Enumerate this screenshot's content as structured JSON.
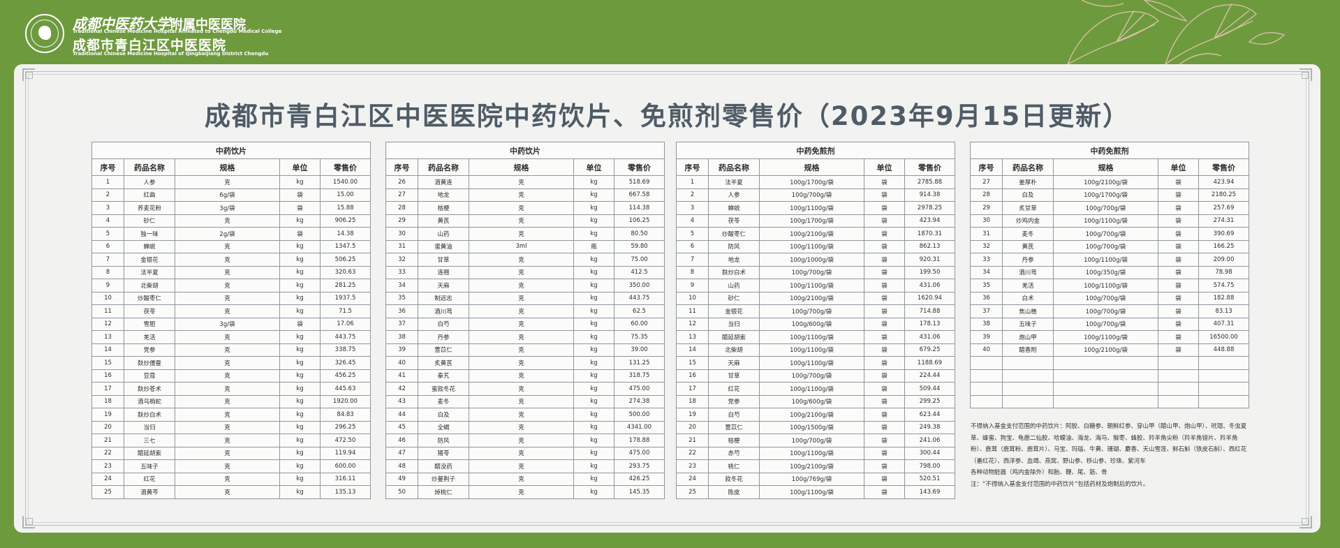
{
  "header": {
    "hospital_cn_calligraphy": "成都中医药大学",
    "hospital_cn_suffix": "附属中医医院",
    "hospital_en_1": "Traditional Chinese Medicine Hospital Affiliated to Chengdu Medical College",
    "hospital_cn_2": "成都市青白江区中医医院",
    "hospital_en_2": "Traditional Chinese Medicine Hospital of Qingbaijiang District Chengdu"
  },
  "title": "成都市青白江区中医医院中药饮片、免煎剂零售价（2023年9月15日更新）",
  "columns": [
    "序号",
    "药品名称",
    "规格",
    "单位",
    "零售价"
  ],
  "tables": [
    {
      "heading": "中药饮片",
      "rows": [
        [
          "1",
          "人参",
          "克",
          "kg",
          "1540.00"
        ],
        [
          "2",
          "红曲",
          "6g/袋",
          "袋",
          "15.00"
        ],
        [
          "3",
          "荞麦花粉",
          "3g/袋",
          "袋",
          "15.88"
        ],
        [
          "4",
          "砂仁",
          "克",
          "kg",
          "906.25"
        ],
        [
          "5",
          "独一味",
          "2g/袋",
          "袋",
          "14.38"
        ],
        [
          "6",
          "蝉蜕",
          "克",
          "kg",
          "1347.5"
        ],
        [
          "7",
          "金银花",
          "克",
          "kg",
          "506.25"
        ],
        [
          "8",
          "法半夏",
          "克",
          "kg",
          "320.63"
        ],
        [
          "9",
          "北柴胡",
          "克",
          "kg",
          "281.25"
        ],
        [
          "10",
          "炒酸枣仁",
          "克",
          "kg",
          "1937.5"
        ],
        [
          "11",
          "茯苓",
          "克",
          "kg",
          "71.5"
        ],
        [
          "12",
          "雪胆",
          "3g/袋",
          "袋",
          "17.06"
        ],
        [
          "13",
          "羌活",
          "克",
          "kg",
          "443.75"
        ],
        [
          "14",
          "党参",
          "克",
          "kg",
          "338.75"
        ],
        [
          "15",
          "麸炒僵蚕",
          "克",
          "kg",
          "326.45"
        ],
        [
          "16",
          "豆蔻",
          "克",
          "kg",
          "456.25"
        ],
        [
          "17",
          "麸炒苍术",
          "克",
          "kg",
          "445.63"
        ],
        [
          "18",
          "酒乌梢蛇",
          "克",
          "kg",
          "1920.00"
        ],
        [
          "19",
          "麸炒白术",
          "克",
          "kg",
          "84.83"
        ],
        [
          "20",
          "当归",
          "克",
          "kg",
          "296.25"
        ],
        [
          "21",
          "三七",
          "克",
          "kg",
          "472.50"
        ],
        [
          "22",
          "醋延胡索",
          "克",
          "kg",
          "119.94"
        ],
        [
          "23",
          "五味子",
          "克",
          "kg",
          "600.00"
        ],
        [
          "24",
          "红花",
          "克",
          "kg",
          "316.11"
        ],
        [
          "25",
          "酒黄芩",
          "克",
          "kg",
          "135.13"
        ]
      ]
    },
    {
      "heading": "中药饮片",
      "rows": [
        [
          "26",
          "酒黄连",
          "克",
          "kg",
          "518.69"
        ],
        [
          "27",
          "地龙",
          "克",
          "kg",
          "667.58"
        ],
        [
          "28",
          "桔梗",
          "克",
          "kg",
          "114.38"
        ],
        [
          "29",
          "黄芪",
          "克",
          "kg",
          "106.25"
        ],
        [
          "30",
          "山药",
          "克",
          "kg",
          "80.50"
        ],
        [
          "31",
          "蛋黄油",
          "3ml",
          "瓶",
          "59.80"
        ],
        [
          "32",
          "甘草",
          "克",
          "kg",
          "75.00"
        ],
        [
          "33",
          "连翘",
          "克",
          "kg",
          "412.5"
        ],
        [
          "34",
          "天麻",
          "克",
          "kg",
          "350.00"
        ],
        [
          "35",
          "制远志",
          "克",
          "kg",
          "443.75"
        ],
        [
          "36",
          "酒川芎",
          "克",
          "kg",
          "62.5"
        ],
        [
          "37",
          "白芍",
          "克",
          "kg",
          "60.00"
        ],
        [
          "38",
          "丹参",
          "克",
          "kg",
          "75.35"
        ],
        [
          "39",
          "薏苡仁",
          "克",
          "kg",
          "39.00"
        ],
        [
          "40",
          "炙黄芪",
          "克",
          "kg",
          "131.25"
        ],
        [
          "41",
          "秦艽",
          "克",
          "kg",
          "318.75"
        ],
        [
          "42",
          "蜜款冬花",
          "克",
          "kg",
          "475.00"
        ],
        [
          "43",
          "麦冬",
          "克",
          "kg",
          "274.38"
        ],
        [
          "44",
          "白及",
          "克",
          "kg",
          "500.00"
        ],
        [
          "45",
          "全蝎",
          "克",
          "kg",
          "4341.00"
        ],
        [
          "46",
          "防风",
          "克",
          "kg",
          "178.88"
        ],
        [
          "47",
          "猪苓",
          "克",
          "kg",
          "475.00"
        ],
        [
          "48",
          "醋没药",
          "克",
          "kg",
          "293.75"
        ],
        [
          "49",
          "炒蔓荆子",
          "克",
          "kg",
          "426.25"
        ],
        [
          "50",
          "焯桃仁",
          "克",
          "kg",
          "145.35"
        ]
      ]
    },
    {
      "heading": "中药免煎剂",
      "rows": [
        [
          "1",
          "法半夏",
          "100g/1700g/袋",
          "袋",
          "2785.88"
        ],
        [
          "2",
          "人参",
          "100g/700g/袋",
          "袋",
          "914.38"
        ],
        [
          "3",
          "蝉蜕",
          "100g/1100g/袋",
          "袋",
          "2978.25"
        ],
        [
          "4",
          "茯苓",
          "100g/1700g/袋",
          "袋",
          "423.94"
        ],
        [
          "5",
          "炒酸枣仁",
          "100g/2100g/袋",
          "袋",
          "1870.31"
        ],
        [
          "6",
          "防风",
          "100g/1100g/袋",
          "袋",
          "862.13"
        ],
        [
          "7",
          "地龙",
          "100g/1000g/袋",
          "袋",
          "920.31"
        ],
        [
          "8",
          "麸炒白术",
          "100g/700g/袋",
          "袋",
          "199.50"
        ],
        [
          "9",
          "山药",
          "100g/1100g/袋",
          "袋",
          "431.06"
        ],
        [
          "10",
          "砂仁",
          "100g/2100g/袋",
          "袋",
          "1620.94"
        ],
        [
          "11",
          "金银花",
          "100g/700g/袋",
          "袋",
          "714.88"
        ],
        [
          "12",
          "当归",
          "100g/600g/袋",
          "袋",
          "178.13"
        ],
        [
          "13",
          "醋延胡索",
          "100g/1100g/袋",
          "袋",
          "431.06"
        ],
        [
          "14",
          "北柴胡",
          "100g/1100g/袋",
          "袋",
          "679.25"
        ],
        [
          "15",
          "天麻",
          "100g/1100g/袋",
          "袋",
          "1188.69"
        ],
        [
          "16",
          "甘草",
          "100g/700g/袋",
          "袋",
          "224.44"
        ],
        [
          "17",
          "红花",
          "100g/1100g/袋",
          "袋",
          "509.44"
        ],
        [
          "18",
          "党参",
          "100g/600g/袋",
          "袋",
          "299.25"
        ],
        [
          "19",
          "白芍",
          "100g/2100g/袋",
          "袋",
          "623.44"
        ],
        [
          "20",
          "薏苡仁",
          "100g/1500g/袋",
          "袋",
          "249.38"
        ],
        [
          "21",
          "桔梗",
          "100g/700g/袋",
          "袋",
          "241.06"
        ],
        [
          "22",
          "赤芍",
          "100g/1100g/袋",
          "袋",
          "300.44"
        ],
        [
          "23",
          "桃仁",
          "100g/2100g/袋",
          "袋",
          "798.00"
        ],
        [
          "24",
          "款冬花",
          "100g/769g/袋",
          "袋",
          "520.51"
        ],
        [
          "25",
          "陈皮",
          "100g/1100g/袋",
          "袋",
          "143.69"
        ]
      ]
    },
    {
      "heading": "中药免煎剂",
      "rows": [
        [
          "27",
          "姜厚朴",
          "100g/2100g/袋",
          "袋",
          "423.94"
        ],
        [
          "28",
          "白及",
          "100g/1700g/袋",
          "袋",
          "2180.25"
        ],
        [
          "29",
          "炙甘草",
          "100g/700g/袋",
          "袋",
          "257.69"
        ],
        [
          "30",
          "炒鸡内金",
          "100g/1100g/袋",
          "袋",
          "274.31"
        ],
        [
          "31",
          "麦冬",
          "100g/700g/袋",
          "袋",
          "390.69"
        ],
        [
          "32",
          "黄芪",
          "100g/700g/袋",
          "袋",
          "166.25"
        ],
        [
          "33",
          "丹参",
          "100g/1100g/袋",
          "袋",
          "209.00"
        ],
        [
          "34",
          "酒川芎",
          "100g/350g/袋",
          "袋",
          "78.98"
        ],
        [
          "35",
          "羌活",
          "100g/1100g/袋",
          "袋",
          "574.75"
        ],
        [
          "36",
          "白术",
          "100g/700g/袋",
          "袋",
          "182.88"
        ],
        [
          "37",
          "焦山楂",
          "100g/700g/袋",
          "袋",
          "83.13"
        ],
        [
          "38",
          "五味子",
          "100g/700g/袋",
          "袋",
          "407.31"
        ],
        [
          "39",
          "炮山甲",
          "100g/1100g/袋",
          "袋",
          "16500.00"
        ],
        [
          "40",
          "醋香附",
          "100g/2100g/袋",
          "袋",
          "448.88"
        ],
        [
          "",
          "",
          "",
          "",
          ""
        ],
        [
          "",
          "",
          "",
          "",
          ""
        ],
        [
          "",
          "",
          "",
          "",
          ""
        ],
        [
          "",
          "",
          "",
          "",
          ""
        ]
      ]
    }
  ],
  "note": {
    "line1": "不得纳入基金支付范围的中药饮片：阿胶、白糖参、朝鲜红参、穿山甲（醋山甲、炮山甲）、玳瑁、冬虫夏草、蜂蜜、狗宝、龟鹿二仙胶、哈蟆油、海龙、海马、猴枣、蜂胶、羚羊角尖粉（羚羊角镑片、羚羊角粉）、鹿茸（鹿茸粉、鹿茸片）、马宝、玛瑙、牛黄、珊瑚、麝香、天山雪莲、鲜石斛（铁皮石斛）、西红花（番红花）、西洋参、血竭、燕窝、野山参、移山参、珍珠、紫河车",
    "line2": "各种动物脏器（鸡内金除外）和胎、鞭、尾、筋、骨",
    "line3": "注：“不得纳入基金支付范围的中药饮片”包括药材及炮制后的饮片。"
  }
}
